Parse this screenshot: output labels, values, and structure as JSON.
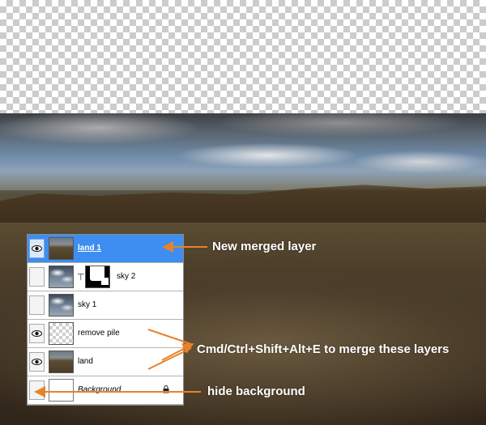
{
  "layers_panel": {
    "layers": [
      {
        "name": "land 1",
        "visible": true,
        "selected": true,
        "thumbnail": "land-thumbnail"
      },
      {
        "name": "sky 2",
        "visible": false,
        "selected": false,
        "thumbnail": "sky-thumbnail",
        "mask": "layer-mask-thumbnail"
      },
      {
        "name": "sky 1",
        "visible": false,
        "selected": false,
        "thumbnail": "sky-thumbnail"
      },
      {
        "name": "remove pile",
        "visible": true,
        "selected": false,
        "thumbnail": "transparent-thumbnail"
      },
      {
        "name": "land",
        "visible": true,
        "selected": false,
        "thumbnail": "land-thumbnail"
      },
      {
        "name": "Background",
        "visible": false,
        "selected": false,
        "thumbnail": "blank-thumbnail",
        "locked": true
      }
    ]
  },
  "annotations": {
    "merged_layer": "New merged layer",
    "merge_shortcut": "Cmd/Ctrl+Shift+Alt+E to merge these layers",
    "hide_background": "hide background"
  },
  "colors": {
    "selection": "#3d8ef0",
    "arrow": "#e8822a",
    "annotation_text": "#ffffff"
  }
}
